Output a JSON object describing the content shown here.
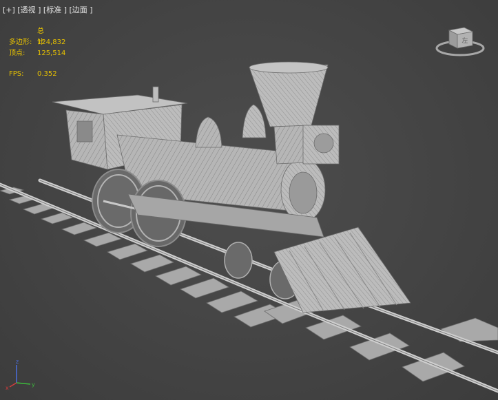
{
  "viewport_menu": {
    "plus": "[+]",
    "view": "[透视 ]",
    "shading": "[标准 ]",
    "edges": "[边面 ]"
  },
  "stats": {
    "header": "总计",
    "polygons_label": "多边形:",
    "polygons_value": "124,832",
    "vertices_label": "顶点:",
    "vertices_value": "125,514",
    "fps_label": "FPS:",
    "fps_value": "0.352"
  },
  "viewcube": {
    "face_label": "左"
  },
  "axis_gizmo": {
    "x": "x",
    "y": "y",
    "z": "z"
  },
  "colors": {
    "background": "#454545",
    "stats_text": "#e8c200",
    "menu_text": "#e6e6e6",
    "model": "#b4b4b4",
    "wire": "#6a6a6a",
    "axis_x": "#d23c3c",
    "axis_y": "#3cbe3c",
    "axis_z": "#4a6ee0"
  },
  "scene": {
    "model": "steam-locomotive-wireframe",
    "ground": "railroad-track"
  }
}
